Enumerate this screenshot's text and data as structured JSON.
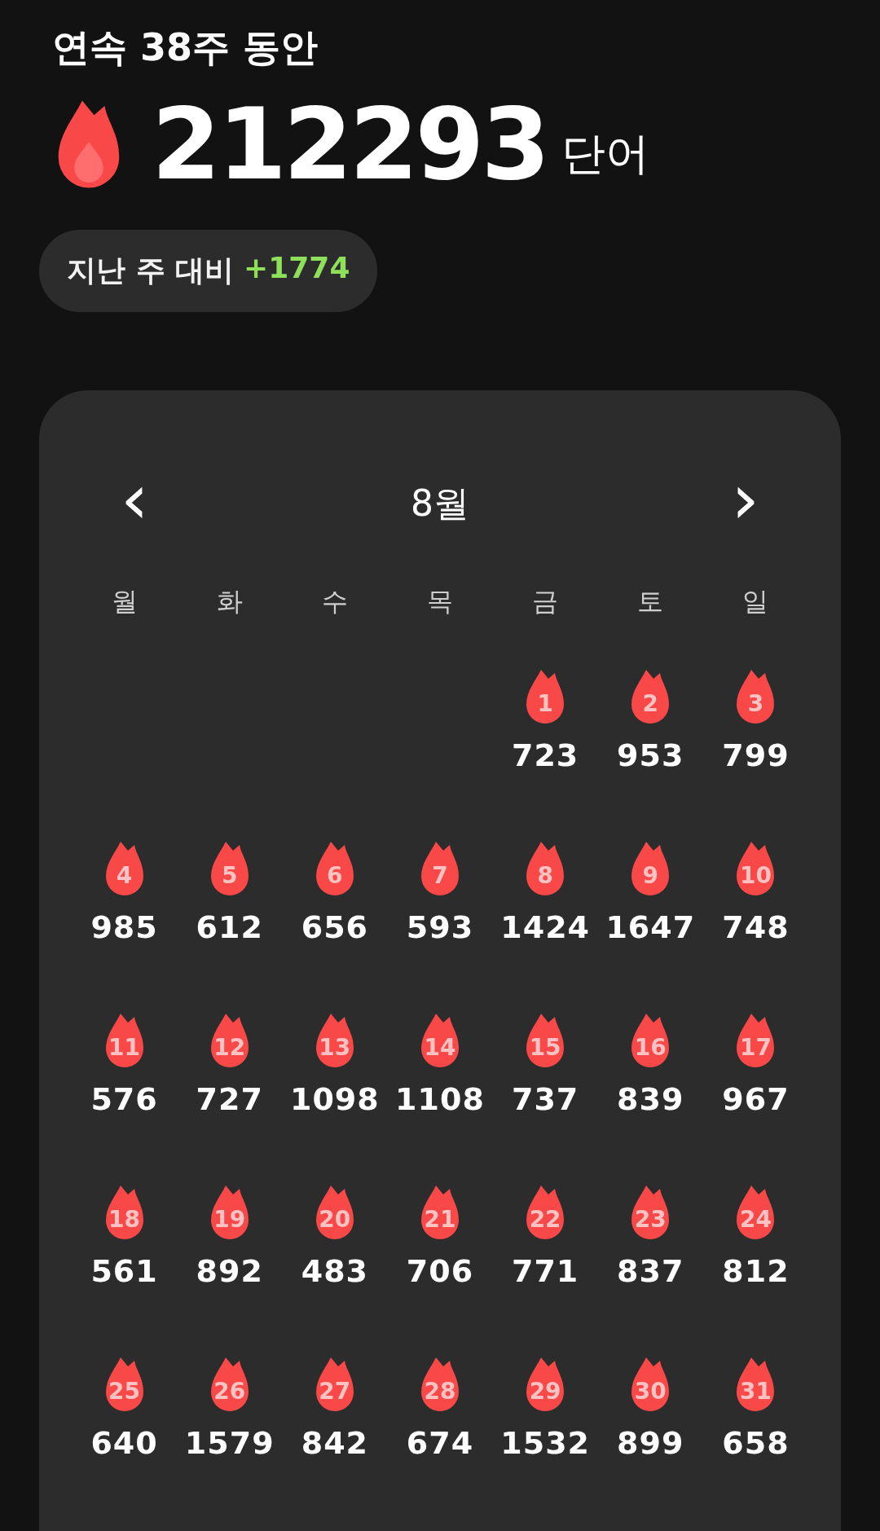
{
  "streak_title": "연속 38주 동안",
  "total": {
    "value": "212293",
    "unit": "단어"
  },
  "comparison": {
    "label": "지난 주 대비",
    "delta": "+1774"
  },
  "calendar": {
    "month": "8월",
    "prev": "‹",
    "next": "›",
    "weekdays": [
      "월",
      "화",
      "수",
      "목",
      "금",
      "토",
      "일"
    ],
    "weeks": [
      [
        {
          "kind": "empty"
        },
        {
          "kind": "empty"
        },
        {
          "kind": "empty"
        },
        {
          "kind": "empty"
        },
        {
          "kind": "day",
          "day": "1",
          "words": "723"
        },
        {
          "kind": "day",
          "day": "2",
          "words": "953"
        },
        {
          "kind": "day",
          "day": "3",
          "words": "799"
        }
      ],
      [
        {
          "kind": "day",
          "day": "4",
          "words": "985"
        },
        {
          "kind": "day",
          "day": "5",
          "words": "612"
        },
        {
          "kind": "day",
          "day": "6",
          "words": "656"
        },
        {
          "kind": "day",
          "day": "7",
          "words": "593"
        },
        {
          "kind": "day",
          "day": "8",
          "words": "1424"
        },
        {
          "kind": "day",
          "day": "9",
          "words": "1647"
        },
        {
          "kind": "day",
          "day": "10",
          "words": "748"
        }
      ],
      [
        {
          "kind": "day",
          "day": "11",
          "words": "576"
        },
        {
          "kind": "day",
          "day": "12",
          "words": "727"
        },
        {
          "kind": "day",
          "day": "13",
          "words": "1098"
        },
        {
          "kind": "day",
          "day": "14",
          "words": "1108"
        },
        {
          "kind": "day",
          "day": "15",
          "words": "737"
        },
        {
          "kind": "day",
          "day": "16",
          "words": "839"
        },
        {
          "kind": "day",
          "day": "17",
          "words": "967"
        }
      ],
      [
        {
          "kind": "day",
          "day": "18",
          "words": "561"
        },
        {
          "kind": "day",
          "day": "19",
          "words": "892"
        },
        {
          "kind": "day",
          "day": "20",
          "words": "483"
        },
        {
          "kind": "day",
          "day": "21",
          "words": "706"
        },
        {
          "kind": "day",
          "day": "22",
          "words": "771"
        },
        {
          "kind": "day",
          "day": "23",
          "words": "837"
        },
        {
          "kind": "day",
          "day": "24",
          "words": "812"
        }
      ],
      [
        {
          "kind": "day",
          "day": "25",
          "words": "640"
        },
        {
          "kind": "day",
          "day": "26",
          "words": "1579"
        },
        {
          "kind": "day",
          "day": "27",
          "words": "842"
        },
        {
          "kind": "day",
          "day": "28",
          "words": "674"
        },
        {
          "kind": "day",
          "day": "29",
          "words": "1532"
        },
        {
          "kind": "day",
          "day": "30",
          "words": "899"
        },
        {
          "kind": "day",
          "day": "31",
          "words": "658"
        }
      ]
    ]
  }
}
